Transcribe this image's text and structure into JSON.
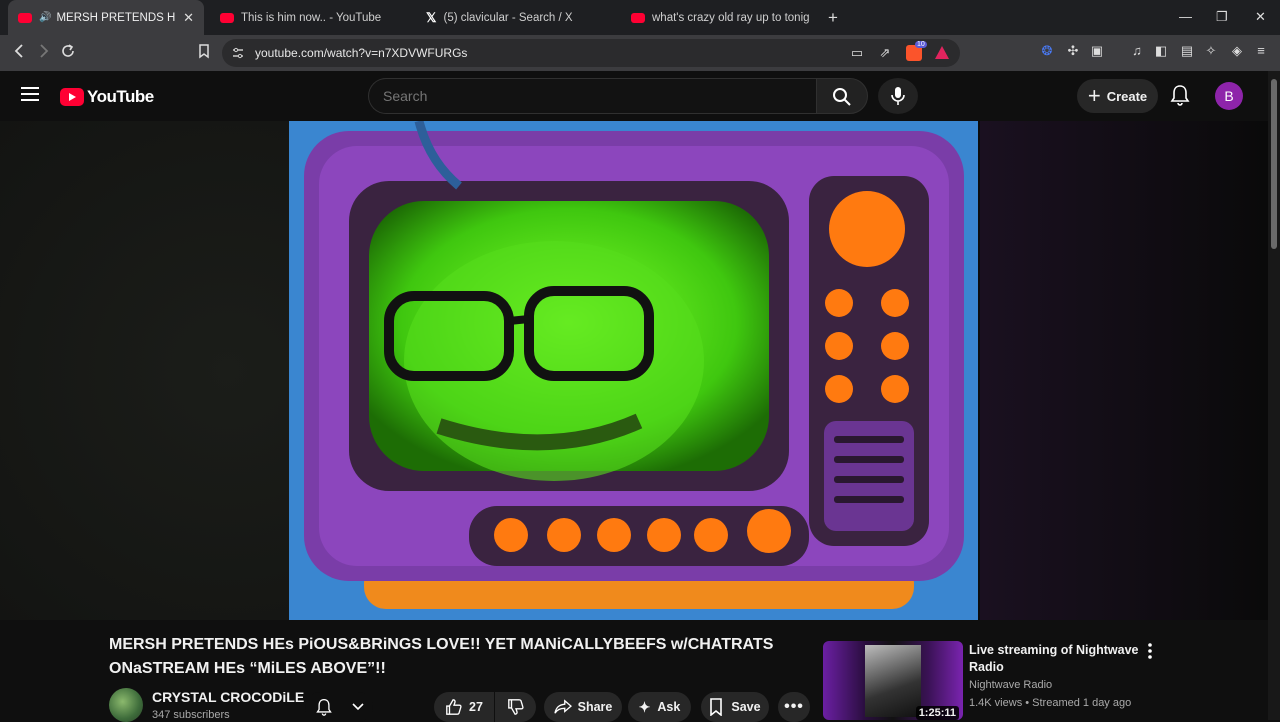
{
  "browser": {
    "tabs": [
      {
        "title": "MERSH PRETENDS HEs PiOUS",
        "favicon": "youtube-favicon",
        "color": "#ff0033",
        "active": true
      },
      {
        "title": "This is him now.. - YouTube",
        "favicon": "youtube-favicon",
        "color": "#ff0033",
        "active": false
      },
      {
        "title": "(5) clavicular - Search / X",
        "favicon": "x-favicon",
        "color": "#ffffff",
        "active": false
      },
      {
        "title": "what's crazy old ray up to tonight? (o",
        "favicon": "youtube-favicon",
        "color": "#ff0033",
        "active": false
      }
    ],
    "url": "youtube.com/watch?v=n7XDVWFURGs",
    "brave_badge": "10"
  },
  "youtube": {
    "logo_text": "YouTube",
    "search_placeholder": "Search",
    "create_label": "Create",
    "avatar_letter": "B",
    "accent_color": "#ff0033"
  },
  "video": {
    "title": "MERSH PRETENDS HEs PiOUS&BRiNGS LOVE!! YET MANiCALLYBEEFS w/CHATRATS ONaSTREAM HEs “MiLES ABOVE”!!",
    "channel": "CRYSTAL CROCODiLE",
    "subscribers": "347 subscribers",
    "likes": "27",
    "share_label": "Share",
    "ask_label": "Ask",
    "save_label": "Save"
  },
  "recommended": [
    {
      "title": "Live streaming of Nightwave Radio",
      "channel": "Nightwave Radio",
      "meta": "1.4K views • Streamed 1 day ago",
      "duration": "1:25:11"
    }
  ]
}
